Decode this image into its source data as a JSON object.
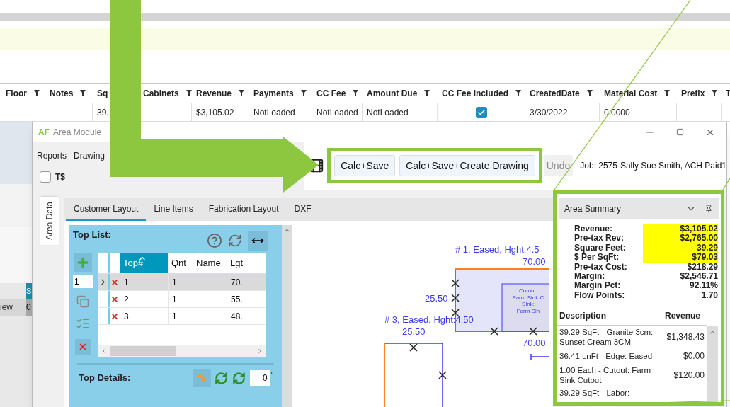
{
  "grid": {
    "columns": [
      "Floor",
      "Notes",
      "Sq",
      "Cabinets",
      "Revenue",
      "Payments",
      "CC Fee",
      "Amount Due",
      "CC Fee Included",
      "CreatedDate",
      "Material Cost",
      "Prefix",
      "T"
    ],
    "row": [
      {
        "kind": "empty"
      },
      {
        "kind": "empty"
      },
      {
        "kind": "text",
        "text": "39."
      },
      {
        "kind": "empty"
      },
      {
        "kind": "text",
        "text": "$3,105.02"
      },
      {
        "kind": "text",
        "text": "NotLoaded"
      },
      {
        "kind": "text",
        "text": "NotLoaded"
      },
      {
        "kind": "text",
        "text": "NotLoaded"
      },
      {
        "kind": "checkbox",
        "checked": true
      },
      {
        "kind": "text",
        "text": "3/30/2022"
      },
      {
        "kind": "text",
        "text": "0.0000"
      },
      {
        "kind": "empty"
      },
      {
        "kind": "empty"
      }
    ]
  },
  "background_app": {
    "tab": "S",
    "row_label": "iew",
    "row_value": "0"
  },
  "window": {
    "logo": "AF",
    "title": "Area Module"
  },
  "menu": [
    "Reports",
    "Drawing"
  ],
  "t_checkbox": {
    "label": "T$",
    "checked": false
  },
  "toolbar": {
    "buttons": [
      {
        "label": "Calc+Save",
        "disabled": false
      },
      {
        "label": "Calc+Save+Create Drawing",
        "disabled": false
      },
      {
        "label": "Undo",
        "disabled": true
      }
    ],
    "job": "Job: 2575-Sally Sue Smith, ACH Paid1"
  },
  "side_tab": "Area Data",
  "tabs": [
    {
      "label": "Customer Layout",
      "selected": true
    },
    {
      "label": "Line Items",
      "selected": false
    },
    {
      "label": "Fabrication Layout",
      "selected": false
    },
    {
      "label": "DXF",
      "selected": false
    }
  ],
  "top_list": {
    "title": "Top List:",
    "add_count": "1",
    "columns": [
      "Top#",
      "Qnt",
      "Name",
      "Lgt"
    ],
    "rows": [
      {
        "selected": true,
        "cells": [
          "1",
          "1",
          "",
          "70."
        ]
      },
      {
        "selected": false,
        "cells": [
          "2",
          "1",
          "",
          "55."
        ]
      },
      {
        "selected": false,
        "cells": [
          "3",
          "1",
          "",
          "48."
        ]
      }
    ]
  },
  "top_details": {
    "title": "Top Details:",
    "angle": "0",
    "unit": "°"
  },
  "drawing": {
    "labels": [
      "# 1, Eased, Hght:4.5",
      "70.00",
      "25.50",
      "# 3, Eased, Hght:4.50",
      "25.50",
      "70.00"
    ],
    "cutout": [
      "Cutout:",
      "Farm Sink C",
      "Sink:",
      "Farm Sin"
    ]
  },
  "summary": {
    "title": "Area Summary",
    "stats": [
      {
        "label": "Revenue:",
        "value": "$3,105.02",
        "highlighted": true
      },
      {
        "label": "Pre-tax Rev:",
        "value": "$2,765.00",
        "highlighted": true
      },
      {
        "label": "Square Feet:",
        "value": "39.29",
        "highlighted": true
      },
      {
        "label": "$ Per SqFt:",
        "value": "$79.03",
        "highlighted": true
      },
      {
        "label": "Pre-tax Cost:",
        "value": "$218.29",
        "highlighted": false
      },
      {
        "label": "Margin:",
        "value": "$2,546.71",
        "highlighted": false
      },
      {
        "label": "Margin Pct:",
        "value": "92.11%",
        "highlighted": false
      },
      {
        "label": "Flow Points:",
        "value": "1.70",
        "highlighted": false
      }
    ],
    "columns": [
      "Description",
      "Revenue"
    ],
    "items": [
      {
        "description": "39.29 SqFt - Granite 3cm: Sunset Cream 3CM",
        "revenue": "$1,348.43"
      },
      {
        "description": "36.41 LnFt - Edge: Eased",
        "revenue": "$0.00"
      },
      {
        "description": "1.00 Each - Cutout: Farm Sink Cutout",
        "revenue": "$120.00"
      },
      {
        "description": "39.29 SqFt - Labor:"
      }
    ]
  }
}
